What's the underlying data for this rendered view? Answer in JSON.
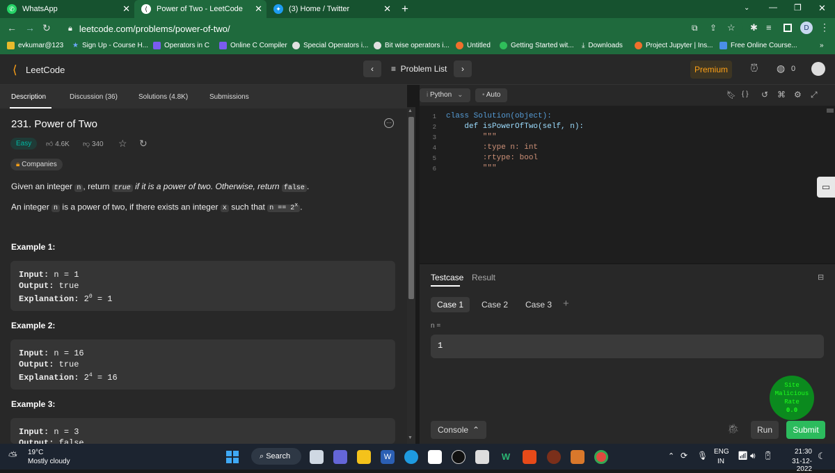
{
  "browser": {
    "tabs": [
      {
        "label": "WhatsApp",
        "icon": "whatsapp-icon"
      },
      {
        "label": "Power of Two - LeetCode",
        "icon": "leetcode-icon"
      },
      {
        "label": "(3) Home / Twitter",
        "icon": "twitter-icon"
      }
    ],
    "url": "leetcode.com/problems/power-of-two/",
    "profile_initial": "D",
    "bookmarks": [
      {
        "label": "evkumar@123",
        "color": "#e8ba2c"
      },
      {
        "label": "Sign Up - Course H...",
        "color": "#3b6fd6"
      },
      {
        "label": "Operators in C",
        "color": "#7a5cf0"
      },
      {
        "label": "Online C Compiler",
        "color": "#7a5cf0"
      },
      {
        "label": "Special Operators i...",
        "color": "#e0e0e0"
      },
      {
        "label": "Bit wise operators i...",
        "color": "#e0e0e0"
      },
      {
        "label": "Untitled",
        "color": "#f0702c"
      },
      {
        "label": "Getting Started wit...",
        "color": "#2fbf5a"
      },
      {
        "label": "Downloads",
        "color": "#ffffff"
      },
      {
        "label": "Project Jupyter | Ins...",
        "color": "#f0702c"
      },
      {
        "label": "Free Online Course...",
        "color": "#4a8fe7"
      }
    ],
    "more_bookmarks": "»"
  },
  "lc_header": {
    "logo": "LeetCode",
    "problem_list": "Problem List",
    "premium": "Premium",
    "coins": "0"
  },
  "left": {
    "tabs": [
      "Description",
      "Discussion (36)",
      "Solutions (4.8K)",
      "Submissions"
    ],
    "title": "231. Power of Two",
    "difficulty": "Easy",
    "likes": "4.6K",
    "dislikes": "340",
    "companies": "Companies",
    "desc1_pre": "Given an integer ",
    "desc1_n": "n",
    "desc1_mid": ", return ",
    "desc1_true": "true",
    "desc1_italic": " if it is a power of two. Otherwise, return ",
    "desc1_false": "false",
    "desc1_end": ".",
    "desc2_pre": "An integer ",
    "desc2_n": "n",
    "desc2_mid": " is a power of two, if there exists an integer ",
    "desc2_x": "x",
    "desc2_mid2": " such that ",
    "desc2_eq": "n == 2",
    "desc2_sup": "x",
    "desc2_end": ".",
    "examples": [
      {
        "heading": "Example 1:",
        "input": "n = 1",
        "output": "true",
        "expl_base": "2",
        "expl_sup": "0",
        "expl_rest": " = 1"
      },
      {
        "heading": "Example 2:",
        "input": "n = 16",
        "output": "true",
        "expl_base": "2",
        "expl_sup": "4",
        "expl_rest": " = 16"
      },
      {
        "heading": "Example 3:",
        "input": "n = 3",
        "output": "false"
      }
    ],
    "labels": {
      "input": "Input:",
      "output": "Output:",
      "explanation": "Explanation:"
    }
  },
  "editor": {
    "language": "Python",
    "mode": "Auto",
    "lines": [
      {
        "n": "1",
        "text": "class Solution(object):"
      },
      {
        "n": "2",
        "text": "    def isPowerOfTwo(self, n):"
      },
      {
        "n": "3",
        "text": "        \"\"\""
      },
      {
        "n": "4",
        "text": "        :type n: int"
      },
      {
        "n": "5",
        "text": "        :rtype: bool"
      },
      {
        "n": "6",
        "text": "        \"\"\""
      }
    ]
  },
  "testcase": {
    "tabs": [
      "Testcase",
      "Result"
    ],
    "cases": [
      "Case 1",
      "Case 2",
      "Case 3"
    ],
    "add": "+",
    "param_label": "n =",
    "param_value": "1",
    "console": "Console",
    "run": "Run",
    "submit": "Submit"
  },
  "badge": {
    "line1": "Site",
    "line2": "Malicious",
    "line3": "Rate",
    "line4": "0.0"
  },
  "taskbar": {
    "weather_temp": "19°C",
    "weather_desc": "Mostly cloudy",
    "search": "Search",
    "lang1": "ENG",
    "lang2": "IN",
    "time": "21:30",
    "date": "31-12-2022"
  },
  "colors": {
    "accent_green": "#2cbb5d",
    "easy": "#00b8a3",
    "premium": "#ffa116",
    "chrome_green": "#1f6a3d"
  }
}
